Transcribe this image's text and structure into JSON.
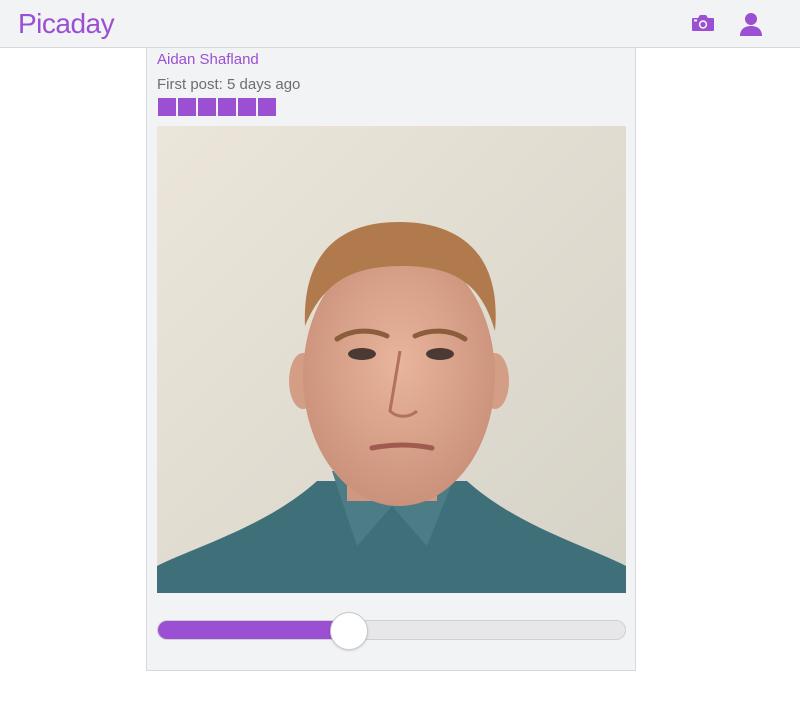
{
  "app": {
    "logo": "Picaday"
  },
  "header": {
    "camera_icon": "camera-icon",
    "user_icon": "user-icon"
  },
  "post": {
    "author": "Aidan Shafland",
    "first_post": "First post: 5 days ago",
    "streak_days": 6,
    "photo": "selfie-photo"
  },
  "timeline_slider": {
    "position_fraction": 0.41
  },
  "colors": {
    "accent": "#9b4fd3",
    "background": "#f2f3f5"
  }
}
